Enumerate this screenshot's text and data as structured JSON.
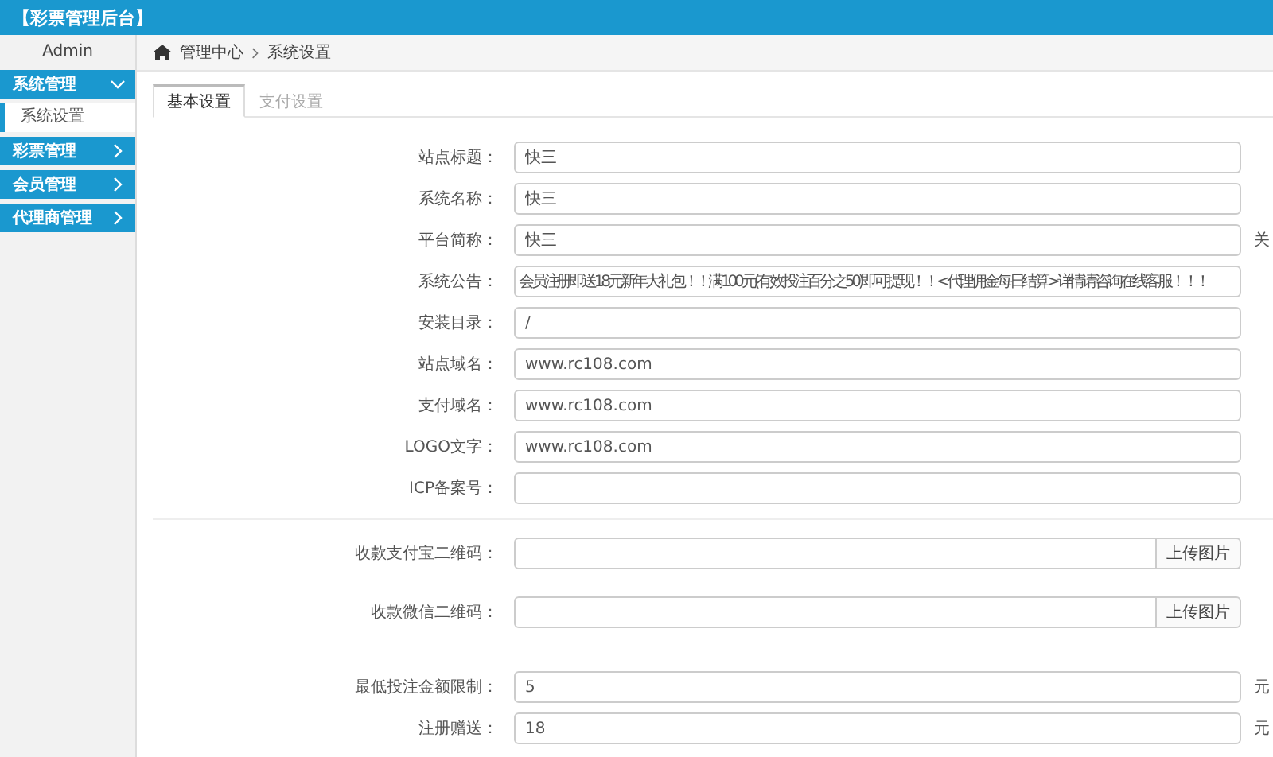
{
  "header": {
    "title": "【彩票管理后台】"
  },
  "sidebar": {
    "user": "Admin",
    "groups": [
      {
        "label": "系统管理",
        "expanded": true,
        "children": [
          {
            "label": "系统设置",
            "selected": true
          }
        ]
      },
      {
        "label": "彩票管理",
        "expanded": false
      },
      {
        "label": "会员管理",
        "expanded": false
      },
      {
        "label": "代理商管理",
        "expanded": false
      }
    ]
  },
  "breadcrumb": [
    "管理中心",
    "系统设置"
  ],
  "tabs": [
    {
      "label": "基本设置",
      "selected": true
    },
    {
      "label": "支付设置",
      "selected": false
    }
  ],
  "sections": [
    {
      "rows": [
        {
          "kind": "text",
          "label": "站点标题：",
          "value": "快三"
        },
        {
          "kind": "text",
          "label": "系统名称：",
          "value": "快三"
        },
        {
          "kind": "text",
          "label": "平台简称：",
          "value": "快三",
          "suffix": "关"
        },
        {
          "kind": "notice",
          "label": "系统公告：",
          "value": "会员注册即送18元新年大礼包！！满100元(有效投注百分之50)即可提现！！<代理佣金每日结算>详情请咨询在线客服！！！"
        },
        {
          "kind": "text",
          "label": "安装目录：",
          "value": "/"
        },
        {
          "kind": "text",
          "label": "站点域名：",
          "value": "www.rc108.com"
        },
        {
          "kind": "text",
          "label": "支付域名：",
          "value": "www.rc108.com"
        },
        {
          "kind": "text",
          "label": "LOGO文字：",
          "value": "www.rc108.com"
        },
        {
          "kind": "text",
          "label": "ICP备案号："
        }
      ]
    },
    {
      "rows": [
        {
          "kind": "upload",
          "label": "收款支付宝二维码：",
          "button": "上传图片"
        },
        {
          "kind": "upload",
          "label": "收款微信二维码：",
          "button": "上传图片"
        }
      ]
    },
    {
      "rows": [
        {
          "kind": "text",
          "label": "最低投注金额限制：",
          "value": "5",
          "suffix": "元"
        },
        {
          "kind": "text",
          "label": "注册赠送：",
          "value": "18",
          "suffix": "元"
        }
      ]
    }
  ]
}
